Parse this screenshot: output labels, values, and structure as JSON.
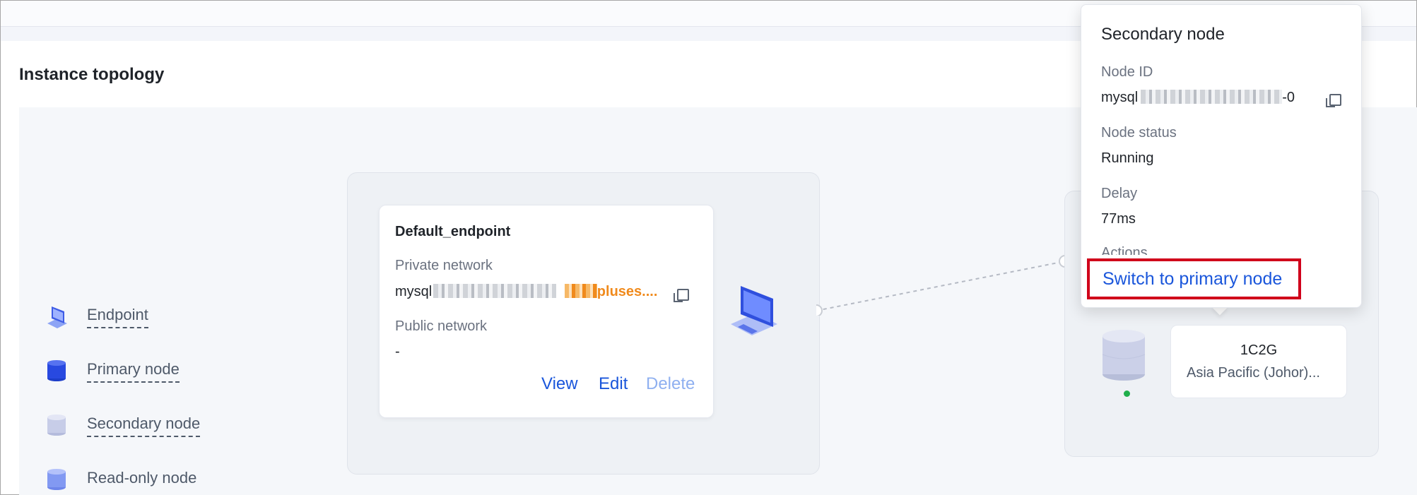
{
  "page": {
    "title": "Instance topology"
  },
  "legend": {
    "items": [
      {
        "key": "endpoint",
        "label": "Endpoint"
      },
      {
        "key": "primary",
        "label": "Primary node"
      },
      {
        "key": "secondary",
        "label": "Secondary node"
      },
      {
        "key": "readonly",
        "label": "Read-only node"
      }
    ]
  },
  "endpoint_card": {
    "name": "Default_endpoint",
    "private_label": "Private network",
    "private_prefix": "mysql",
    "private_suffix": "pluses....",
    "public_label": "Public network",
    "public_value": "-",
    "actions": {
      "view": "View",
      "edit": "Edit",
      "delete": "Delete"
    }
  },
  "node_card": {
    "spec": "1C2G",
    "zone": "Asia Pacific (Johor)..."
  },
  "popover": {
    "title": "Secondary node",
    "node_id_label": "Node ID",
    "node_id_prefix": "mysql",
    "node_id_suffix": "-0",
    "status_label": "Node status",
    "status_value": "Running",
    "delay_label": "Delay",
    "delay_value": "77ms",
    "actions_label": "Actions",
    "switch_action": "Switch to primary node"
  },
  "colors": {
    "accent_link": "#1a56db",
    "highlight_border": "#d0021b",
    "status_running": "#1fae4b",
    "redacted_orange": "#f08a1c"
  },
  "icons": [
    "endpoint-icon",
    "primary-node-icon",
    "secondary-node-icon",
    "read-only-node-icon",
    "copy-icon",
    "computer-icon",
    "database-icon"
  ]
}
